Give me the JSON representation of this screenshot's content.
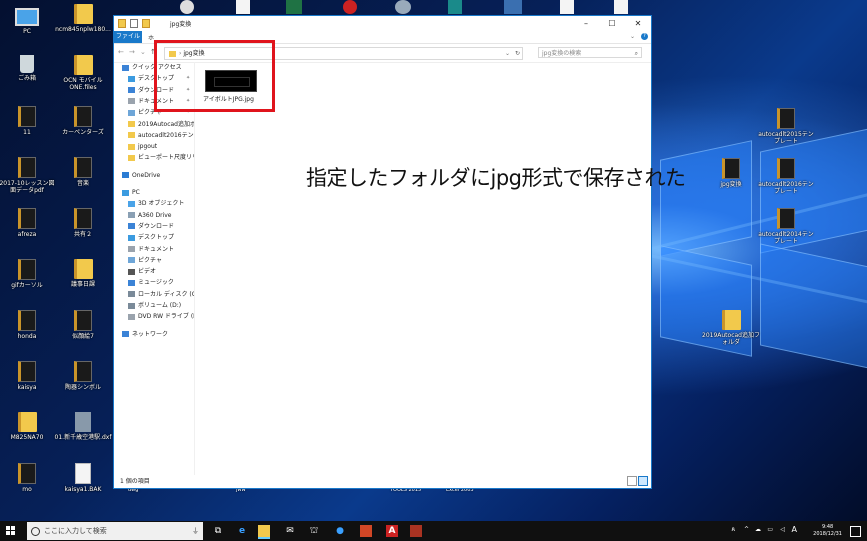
{
  "desktop": {
    "left_icons": [
      {
        "label": "PC",
        "type": "pc"
      },
      {
        "label": "ncm845nplw180...",
        "type": "folder"
      },
      {
        "label": "ごみ箱",
        "type": "bin"
      },
      {
        "label": "OCN モバイル ONE.files",
        "type": "folder"
      },
      {
        "label": "11",
        "type": "dark"
      },
      {
        "label": "カーペンターズ",
        "type": "dark"
      },
      {
        "label": "2017-10レッスン図面データpdf",
        "type": "dark"
      },
      {
        "label": "音楽",
        "type": "dark"
      },
      {
        "label": "afreza",
        "type": "dark"
      },
      {
        "label": "共有２",
        "type": "dark"
      },
      {
        "label": "gifカーソル",
        "type": "dark"
      },
      {
        "label": "議事日課",
        "type": "folder"
      },
      {
        "label": "honda",
        "type": "dark"
      },
      {
        "label": "似顔絵7",
        "type": "dark"
      },
      {
        "label": "kaisya",
        "type": "dark"
      },
      {
        "label": "陶器シンボル",
        "type": "dark"
      },
      {
        "label": "M825NA70",
        "type": "folder"
      },
      {
        "label": "01.新千歳空港駅.dxf",
        "type": "dxf"
      },
      {
        "label": "mo",
        "type": "dark"
      },
      {
        "label": "kaisya1.BAK",
        "type": "file"
      }
    ],
    "right_icons": [
      {
        "label": "autocadlt2015テンプレート",
        "type": "dark"
      },
      {
        "label": "jpg変換",
        "type": "dark"
      },
      {
        "label": "autocadlt2016テンプレート",
        "type": "dark"
      },
      {
        "label": "autocadlt2014テンプレート",
        "type": "dark"
      },
      {
        "label": "2019Autocad追加フォルダ",
        "type": "folder"
      }
    ],
    "below_window_labels": [
      "dwg",
      "jww",
      "TOOLS 2015",
      "Excel 2003"
    ]
  },
  "explorer": {
    "title": "jpg変換",
    "ribbon_file": "ファイル",
    "ribbon_tab": "ホ",
    "address_path": "jpg変換",
    "search_placeholder": "jpg変換の検索",
    "sidebar": [
      {
        "label": "クイック アクセス",
        "icon": "star-icon",
        "color": "#3b83d6",
        "pin": false
      },
      {
        "label": "デスクトップ",
        "icon": "desktop-icon",
        "color": "#3b9be0",
        "pin": true
      },
      {
        "label": "ダウンロード",
        "icon": "download-icon",
        "color": "#3b83d6",
        "pin": true
      },
      {
        "label": "ドキュメント",
        "icon": "document-icon",
        "color": "#9aa3ad",
        "pin": true
      },
      {
        "label": "ピクチャ",
        "icon": "picture-icon",
        "color": "#6ea6d8",
        "pin": true
      },
      {
        "label": "2019Autocad追加ボタン",
        "icon": "folder-icon",
        "color": "#f2c94c",
        "pin": false
      },
      {
        "label": "autocadlt2016テンプ",
        "icon": "folder-icon",
        "color": "#f2c94c",
        "pin": false
      },
      {
        "label": "jpgout",
        "icon": "folder-icon",
        "color": "#f2c94c",
        "pin": false
      },
      {
        "label": "ビューポート尺度リリック",
        "icon": "folder-icon",
        "color": "#f2c94c",
        "pin": false
      },
      {
        "label": "OneDrive",
        "icon": "cloud-icon",
        "color": "#2b7cd3",
        "pin": false
      },
      {
        "label": "PC",
        "icon": "pc-icon",
        "color": "#3b9be0",
        "pin": false
      },
      {
        "label": "3D オブジェクト",
        "icon": "cube-icon",
        "color": "#4aa3e8",
        "pin": false
      },
      {
        "label": "A360 Drive",
        "icon": "drive-icon",
        "color": "#8aa0b4",
        "pin": false
      },
      {
        "label": "ダウンロード",
        "icon": "download-icon",
        "color": "#3b83d6",
        "pin": false
      },
      {
        "label": "デスクトップ",
        "icon": "desktop-icon",
        "color": "#3b9be0",
        "pin": false
      },
      {
        "label": "ドキュメント",
        "icon": "document-icon",
        "color": "#9aa3ad",
        "pin": false
      },
      {
        "label": "ピクチャ",
        "icon": "picture-icon",
        "color": "#6ea6d8",
        "pin": false
      },
      {
        "label": "ビデオ",
        "icon": "video-icon",
        "color": "#555555",
        "pin": false
      },
      {
        "label": "ミュージック",
        "icon": "music-icon",
        "color": "#3b83d6",
        "pin": false
      },
      {
        "label": "ローカル ディスク (C:)",
        "icon": "disk-icon",
        "color": "#7a8a99",
        "pin": false
      },
      {
        "label": "ボリューム (D:)",
        "icon": "disk-icon",
        "color": "#7a8a99",
        "pin": false
      },
      {
        "label": "DVD RW ドライブ (E:)",
        "icon": "dvd-icon",
        "color": "#9aa3ad",
        "pin": false
      },
      {
        "label": "ネットワーク",
        "icon": "network-icon",
        "color": "#3b83d6",
        "pin": false
      }
    ],
    "file": {
      "name": "アイボルトJPG.jpg"
    },
    "annotation": "指定したフォルダにjpg形式で保存された",
    "status_count": "1 個の項目",
    "highlight_color": "#e0141c"
  },
  "taskbar": {
    "search_placeholder": "ここに入力して検索",
    "clock_time": "9:48",
    "clock_date": "2018/12/31",
    "ime": "A"
  }
}
